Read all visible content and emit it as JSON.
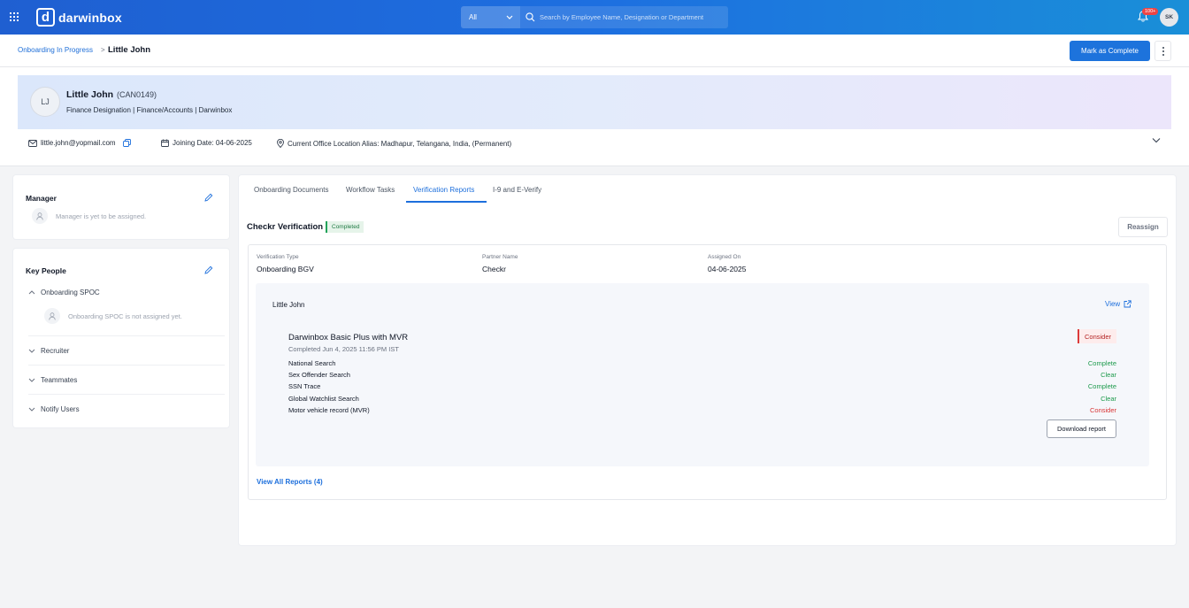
{
  "topbar": {
    "logo_letter": "d",
    "logo_text": "darwinbox",
    "search_scope": "All",
    "search_placeholder": "Search by Employee Name, Designation or Department",
    "notification_badge": "100+",
    "user_initials": "SK",
    "icons": [
      "apps-grid-icon",
      "search-icon",
      "chevron-down-icon",
      "bell-icon"
    ]
  },
  "breadcrumb": {
    "parent": "Onboarding In Progress",
    "separator": ">",
    "current": "Little John"
  },
  "actions": {
    "mark_complete": "Mark as Complete"
  },
  "profile": {
    "initials": "LJ",
    "name": "Little John",
    "code": "(CAN0149)",
    "meta": "Finance Designation | Finance/Accounts | Darwinbox",
    "email": "little.john@yopmail.com",
    "joining_date": "Joining Date: 04-06-2025",
    "location": "Current Office Location Alias: Madhapur, Telangana, India, (Permanent)"
  },
  "manager_card": {
    "title": "Manager",
    "empty_text": "Manager is yet to be assigned."
  },
  "key_people_card": {
    "title": "Key People",
    "sections": [
      {
        "label": "Onboarding SPOC",
        "expanded": true,
        "empty_text": "Onboarding SPOC is not assigned yet."
      },
      {
        "label": "Recruiter",
        "expanded": false
      },
      {
        "label": "Teammates",
        "expanded": false
      },
      {
        "label": "Notify Users",
        "expanded": false
      }
    ]
  },
  "tabs": [
    {
      "label": "Onboarding Documents",
      "active": false
    },
    {
      "label": "Workflow Tasks",
      "active": false
    },
    {
      "label": "Verification Reports",
      "active": true
    },
    {
      "label": "I-9 and E-Verify",
      "active": false
    }
  ],
  "verification": {
    "title": "Checkr Verification",
    "status": "Completed",
    "reassign": "Reassign",
    "fields": [
      {
        "label": "Verification Type",
        "value": "Onboarding BGV"
      },
      {
        "label": "Partner Name",
        "value": "Checkr"
      },
      {
        "label": "Assigned On",
        "value": "04-06-2025"
      }
    ],
    "report": {
      "candidate": "Little John",
      "view_label": "View",
      "package": "Darwinbox Basic Plus with MVR",
      "completed": "Completed Jun 4, 2025 11:56 PM IST",
      "overall": "Consider",
      "checks": [
        {
          "name": "National Search",
          "result": "Complete",
          "color": "#1c9a4b"
        },
        {
          "name": "Sex Offender Search",
          "result": "Clear",
          "color": "#1c9a4b"
        },
        {
          "name": "SSN Trace",
          "result": "Complete",
          "color": "#1c9a4b"
        },
        {
          "name": "Global Watchlist Search",
          "result": "Clear",
          "color": "#1c9a4b"
        },
        {
          "name": "Motor vehicle record (MVR)",
          "result": "Consider",
          "color": "#d93535"
        }
      ],
      "download": "Download report"
    },
    "view_all": "View All Reports (4)"
  },
  "colors": {
    "brand_blue": "#1d73dc",
    "success_green": "#1c9a4b",
    "danger_red": "#d93535"
  }
}
